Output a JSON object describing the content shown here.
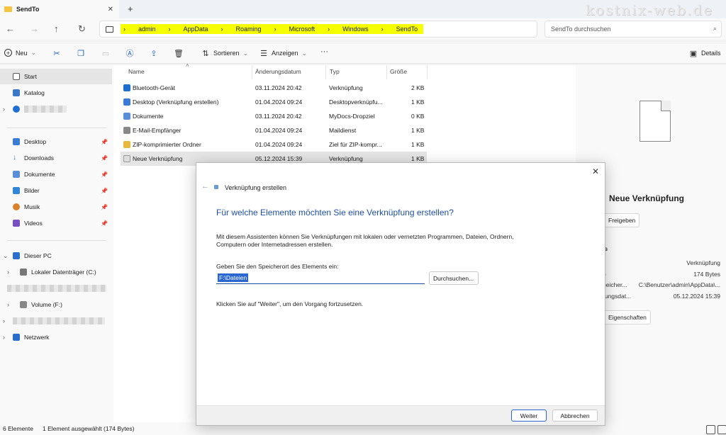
{
  "window": {
    "tab_title": "SendTo",
    "tab_close": "✕",
    "new_tab": "+",
    "watermark": "kostnix-web.de"
  },
  "address": {
    "crumbs": [
      "admin",
      "AppData",
      "Roaming",
      "Microsoft",
      "Windows",
      "SendTo"
    ],
    "separator": "›",
    "search_placeholder": "SendTo durchsuchen"
  },
  "toolbar": {
    "new_label": "Neu",
    "sort_label": "Sortieren",
    "view_label": "Anzeigen",
    "more_label": "···",
    "details_label": "Details"
  },
  "sidebar": {
    "start": "Start",
    "katalog": "Katalog",
    "desktop": "Desktop",
    "downloads": "Downloads",
    "dokumente": "Dokumente",
    "bilder": "Bilder",
    "musik": "Musik",
    "videos": "Videos",
    "dieser_pc": "Dieser PC",
    "lokaler": "Lokaler Datenträger (C:)",
    "volume": "Volume (F:)",
    "netzwerk": "Netzwerk"
  },
  "columns": {
    "name": "Name",
    "date": "Änderungsdatum",
    "type": "Typ",
    "size": "Größe"
  },
  "files": [
    {
      "name": "Bluetooth-Gerät",
      "date": "03.11.2024 20:42",
      "type": "Verknüpfung",
      "size": "2 KB",
      "color": "#1f6fd1"
    },
    {
      "name": "Desktop (Verknüpfung erstellen)",
      "date": "01.04.2024 09:24",
      "type": "Desktopverknüpfu...",
      "size": "1 KB",
      "color": "#3a7bd5"
    },
    {
      "name": "Dokumente",
      "date": "03.11.2024 20:42",
      "type": "MyDocs-Dropziel",
      "size": "0 KB",
      "color": "#5a8fd8"
    },
    {
      "name": "E-Mail-Empfänger",
      "date": "01.04.2024 09:24",
      "type": "Maildienst",
      "size": "1 KB",
      "color": "#888888"
    },
    {
      "name": "ZIP-komprimierter Ordner",
      "date": "01.04.2024 09:24",
      "type": "Ziel für ZIP-kompr...",
      "size": "1 KB",
      "color": "#e8b93b"
    },
    {
      "name": "Neue Verknüpfung",
      "date": "05.12.2024 15:39",
      "type": "Verknüpfung",
      "size": "1 KB",
      "color": "#dddddd"
    }
  ],
  "details": {
    "title": "Neue Verknüpfung",
    "share_button": "Freigeben",
    "section": "ls",
    "type_value": "Verknüpfung",
    "size_value": "174 Bytes",
    "path_label": "peicher...",
    "path_value": "C:\\Benutzer\\admin\\AppData\\...",
    "date_label": "rungsdat...",
    "date_value": "05.12.2024 15:39",
    "properties_button": "Eigenschaften"
  },
  "status": {
    "count": "6 Elemente",
    "selection": "1 Element ausgewählt (174 Bytes)"
  },
  "dialog": {
    "window_title": "Verknüpfung erstellen",
    "close": "✕",
    "back": "←",
    "heading": "Für welche Elemente möchten Sie eine Verknüpfung erstellen?",
    "description": "Mit diesem Assistenten können Sie Verknüpfungen mit lokalen oder vernetzten Programmen, Dateien, Ordnern, Computern oder Internetadressen erstellen.",
    "location_label": "Geben Sie den Speicherort des Elements ein:",
    "location_value": "F:\\Dateien",
    "browse_button": "Durchsuchen...",
    "hint": "Klicken Sie auf \"Weiter\", um den Vorgang fortzusetzen.",
    "next_button": "Weiter",
    "cancel_button": "Abbrechen"
  },
  "colors": {
    "accent": "#1e4fa6",
    "highlight": "#f6ff00",
    "selection": "#e5e5e5"
  }
}
